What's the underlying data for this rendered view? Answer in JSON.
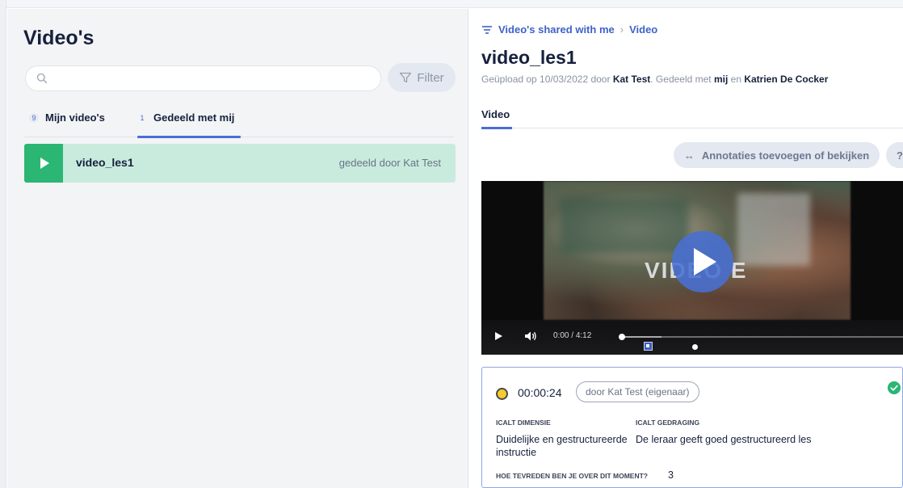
{
  "left": {
    "title": "Video's",
    "search": {
      "placeholder": "",
      "value": ""
    },
    "filter_label": "Filter",
    "tabs": [
      {
        "count": "9",
        "label": "Mijn video's"
      },
      {
        "count": "1",
        "label": "Gedeeld met mij"
      }
    ],
    "videos": [
      {
        "name": "video_les1",
        "shared_by": "gedeeld door Kat Test"
      }
    ]
  },
  "right": {
    "breadcrumb": {
      "parent": "Video's shared with me",
      "sep": "›",
      "current": "Video"
    },
    "title": "video_les1",
    "upload": {
      "prefix": "Geüpload op 10/03/2022 door ",
      "uploader": "Kat Test",
      "mid": ". Gedeeld met ",
      "shared1": "mij",
      "conj": " en ",
      "shared2": "Katrien De Cocker"
    },
    "tab_label": "Video",
    "annotate_button": "Annotaties toevoegen of bekijken",
    "annotate_icon": "↔",
    "help_label": "?",
    "player": {
      "overlay_text": "VIDEO E",
      "current_time": "0:00",
      "duration": "4:12",
      "time_sep": " / ",
      "progress_fraction": 0.0
    },
    "annotation": {
      "timecode": "00:00:24",
      "owner": "door Kat Test (eigenaar)",
      "label_dimension": "ICALT DIMENSIE",
      "value_dimension": "Duidelijke en gestructureerde instructie",
      "label_behaviour": "ICALT GEDRAGING",
      "value_behaviour": "De leraar geeft goed gestructureerd les",
      "label_question": "HOE TEVREDEN BEN JE OVER DIT MOMENT?",
      "value_question": "3",
      "status_color": "#f5cd2b",
      "check_color": "#2bb673"
    }
  }
}
